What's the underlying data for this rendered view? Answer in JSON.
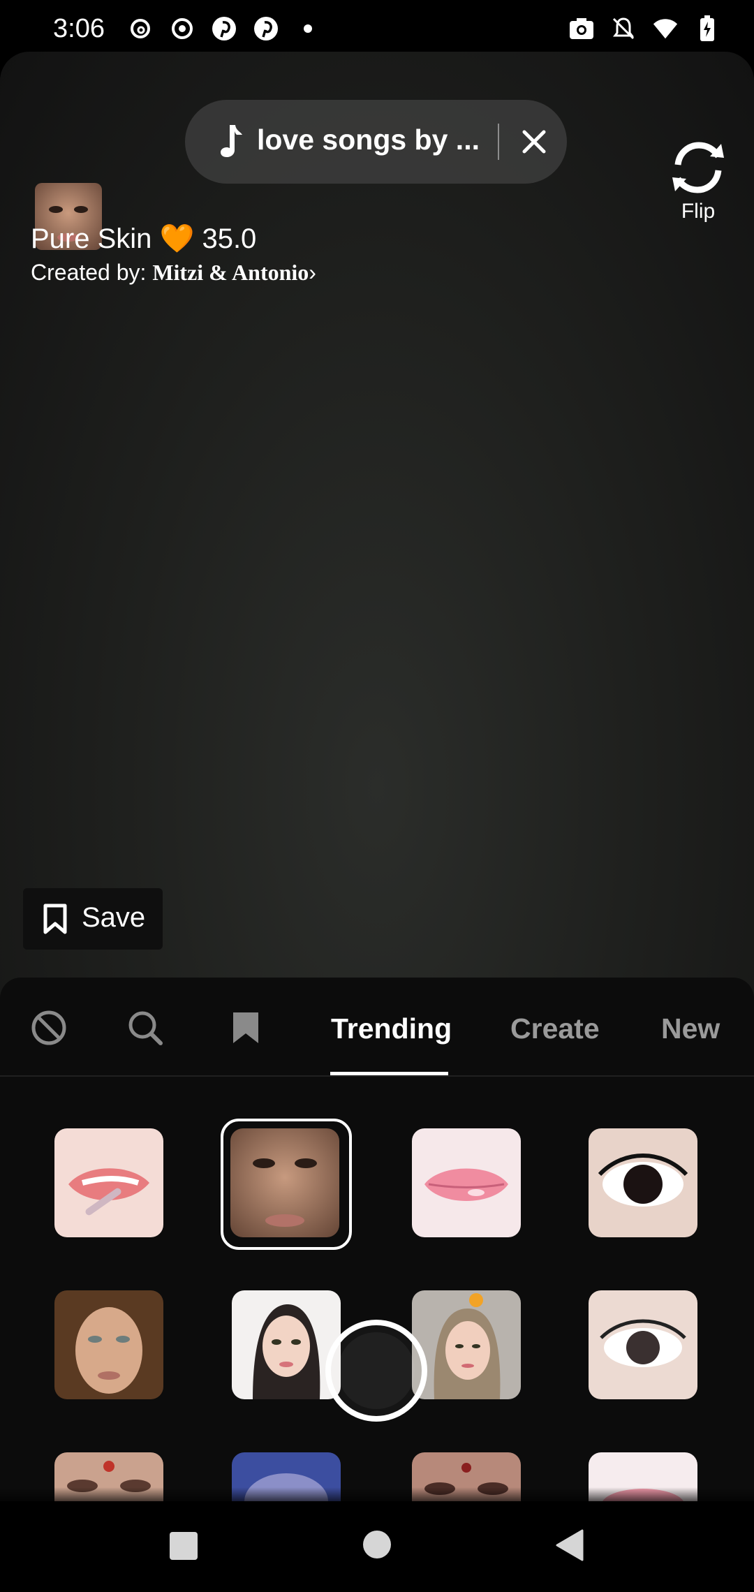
{
  "status_bar": {
    "time": "3:06",
    "left_icons": [
      "threads-icon",
      "record-icon",
      "pinterest-icon",
      "pinterest-icon",
      "dot-icon"
    ],
    "right_icons": [
      "screenshot-icon",
      "mute-icon",
      "wifi-icon",
      "battery-charging-icon"
    ]
  },
  "music": {
    "title": "love songs by ..."
  },
  "flip": {
    "label": "Flip"
  },
  "effect": {
    "name": "Pure Skin 🧡 35.0",
    "creator_prefix": "Created by: ",
    "creator_names": "Mitzi & Antonio",
    "chevron": "›"
  },
  "save": {
    "label": "Save"
  },
  "tabs": {
    "trending": "Trending",
    "create": "Create",
    "new": "New",
    "active": "Trending"
  },
  "grid": {
    "items": [
      "lip-gloss-effect",
      "face-smoothing-effect",
      "pink-lips-effect",
      "eyelash-effect",
      "beauty-face-effect",
      "portrait-effect",
      "cute-selfie-effect",
      "lash-lift-effect",
      "bindi-eyes-effect",
      "blue-filter-effect",
      "jewel-eyes-effect",
      "rosy-lips-effect"
    ],
    "selected_index": 1
  },
  "colors": {
    "accent_orange": "#f5a63a",
    "tab_inactive": "#9a9a9a",
    "panel_bg": "#0c0c0c"
  }
}
